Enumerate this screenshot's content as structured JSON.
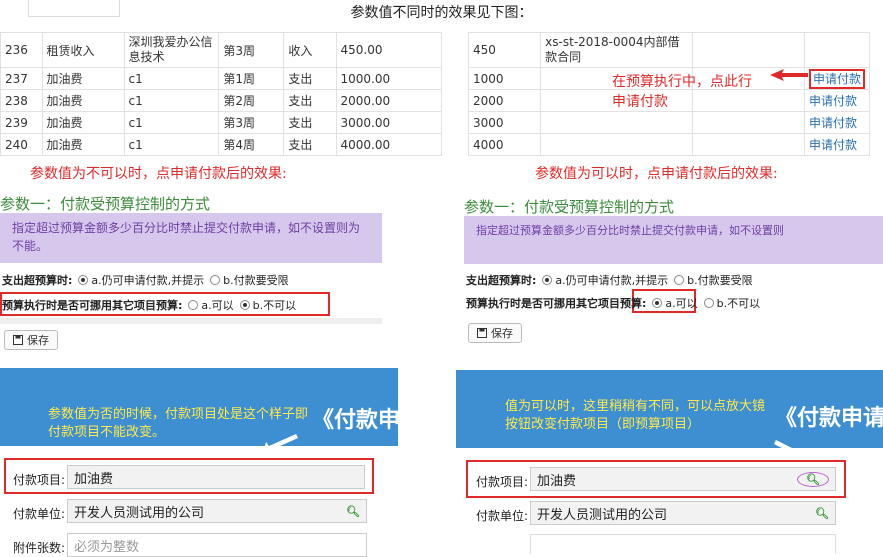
{
  "header": {
    "title": "参数值不同时的效果见下图："
  },
  "table_left": {
    "rows": [
      {
        "id": "236",
        "name": "租赁收入",
        "company": "深圳我爱办公信息技术",
        "week": "第3周",
        "type": "收入",
        "amount": "450.00"
      },
      {
        "id": "237",
        "name": "加油费",
        "company": "c1",
        "week": "第1周",
        "type": "支出",
        "amount": "1000.00"
      },
      {
        "id": "238",
        "name": "加油费",
        "company": "c1",
        "week": "第2周",
        "type": "支出",
        "amount": "2000.00"
      },
      {
        "id": "239",
        "name": "加油费",
        "company": "c1",
        "week": "第3周",
        "type": "支出",
        "amount": "3000.00"
      },
      {
        "id": "240",
        "name": "加油费",
        "company": "c1",
        "week": "第4周",
        "type": "支出",
        "amount": "4000.00"
      }
    ]
  },
  "table_right": {
    "rows": [
      {
        "amount": "450",
        "contract": "xs-st-2018-0004内部借款合同",
        "action": ""
      },
      {
        "amount": "1000",
        "contract": "",
        "action": "申请付款"
      },
      {
        "amount": "2000",
        "contract": "",
        "action": "申请付款"
      },
      {
        "amount": "3000",
        "contract": "",
        "action": "申请付款"
      },
      {
        "amount": "4000",
        "contract": "",
        "action": "申请付款"
      }
    ]
  },
  "annotations": {
    "apply_note": "在预算执行中，点此行申请付款",
    "left_caption": "参数值为不可以时，点申请付款后的效果:",
    "right_caption": "参数值为可以时，点申请付款后的效果:",
    "left_blue_note": "参数值为否的时候，付款项目处是这个样子即付款项目不能改变。",
    "right_blue_note": "值为可以时，这里稍稍有不同，可以点放大镜按钮改变付款项目（即预算项目）"
  },
  "settings_panel": {
    "title": "参数一：付款受预算控制的方式",
    "info_left": "指定超过预算金额多少百分比时禁止提交付款申请，如不设置则为不能。",
    "info_right": "指定超过预算金额多少百分比时禁止提交付款申请，如不设置则",
    "row1_label": "支出超预算时:",
    "row1_opt_a": "a.仍可申请付款,并提示",
    "row1_opt_b": "b.付款要受限",
    "row2_label": "预算执行时是否可挪用其它项目预算:",
    "row2_opt_a": "a.可以",
    "row2_opt_b": "b.不可以",
    "save_label": "保存"
  },
  "payment_form": {
    "big_title": "《付款申请",
    "project_label": "付款项目:",
    "project_value": "加油费",
    "unit_label": "付款单位:",
    "unit_value": "开发人员测试用的公司",
    "attach_label": "附件张数:",
    "attach_placeholder": "必须为整数"
  },
  "colors": {
    "accent_red": "#e02a2a",
    "green": "#3c8b3c",
    "info_bg": "#d6c8ec",
    "banner_blue": "#3d8fd1",
    "note_yellow": "#ffe94a",
    "link_blue": "#2a6fb0"
  }
}
